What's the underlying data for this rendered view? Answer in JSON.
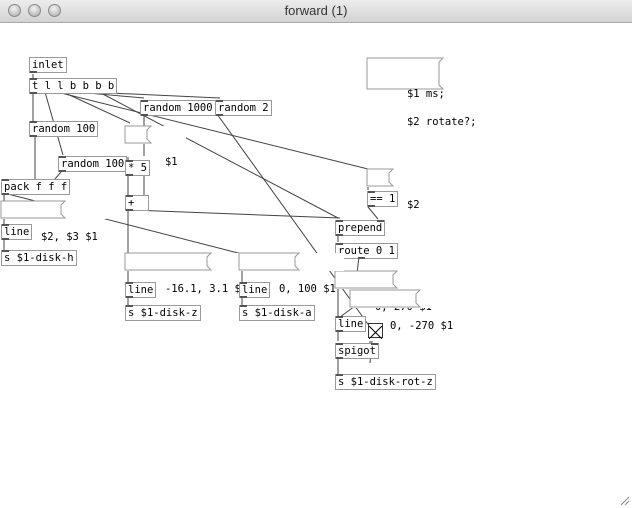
{
  "window": {
    "title": "forward (1)"
  },
  "objects": {
    "inlet": "inlet",
    "trigger": "t l l b b b b",
    "random1000": "random 1000",
    "random2": "random 2",
    "random100a": "random 100",
    "dollar1": "$1",
    "random100b": "random 100",
    "times5": "* 5",
    "pack": "pack f f f",
    "msg_dollar2_3_1": "$2, $3 $1",
    "line_h": "line",
    "send_h": "s $1-disk-h",
    "plus": "+",
    "dollar2": "$2",
    "eq1": "== 1",
    "prepend": "prepend",
    "route": "route 0 1",
    "msg_z": "-16.1, 3.1 $1",
    "msg_a": "0, 100 $1",
    "line_z": "line",
    "line_a": "line",
    "send_z": "s $1-disk-z",
    "send_a": "s $1-disk-a",
    "msg_270": "0, 270 $1",
    "msg_neg270": "0, -270 $1",
    "line_rot": "line",
    "spigot": "spigot",
    "send_rot": "s $1-disk-rot-z",
    "msg_ms_line1": "$1 ms;",
    "msg_ms_line2": "$2 rotate?;"
  },
  "toggle": {
    "checked": true
  }
}
